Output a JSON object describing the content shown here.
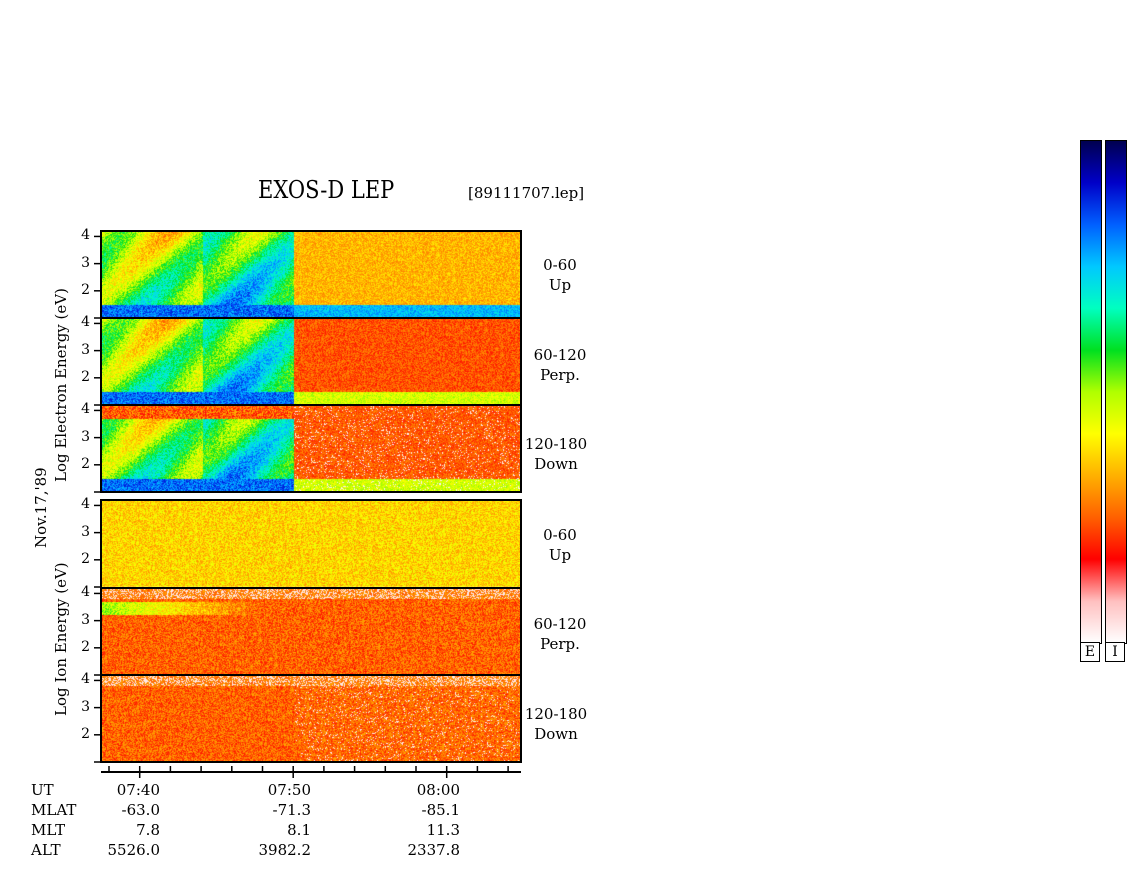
{
  "header": {
    "title": "EXOS-D LEP",
    "filename": "[89111707.lep]"
  },
  "date_label": "Nov.17,'89",
  "electron_axis_label": "Log  Electron  Energy (eV)",
  "ion_axis_label": "Log  Ion  Energy (eV)",
  "panels": [
    {
      "angle": "0-60",
      "direction": "Up"
    },
    {
      "angle": "60-120",
      "direction": "Perp."
    },
    {
      "angle": "120-180",
      "direction": "Down"
    },
    {
      "angle": "0-60",
      "direction": "Up"
    },
    {
      "angle": "60-120",
      "direction": "Perp."
    },
    {
      "angle": "120-180",
      "direction": "Down"
    }
  ],
  "ephemeris": {
    "rows": [
      {
        "label": "UT",
        "values": [
          "07:40",
          "07:50",
          "08:00"
        ]
      },
      {
        "label": "MLAT",
        "values": [
          "-63.0",
          "-71.3",
          "-85.1"
        ]
      },
      {
        "label": "MLT",
        "values": [
          "7.8",
          "8.1",
          "11.3"
        ]
      },
      {
        "label": "ALT",
        "values": [
          "5526.0",
          "3982.2",
          "2337.8"
        ]
      }
    ]
  },
  "colorbars": [
    {
      "label": "E"
    },
    {
      "label": "I"
    }
  ],
  "chart_data": {
    "type": "heatmap",
    "title": "EXOS-D LEP",
    "x_axis": {
      "label": "UT",
      "ticks": [
        "07:40",
        "07:50",
        "08:00"
      ]
    },
    "y_axis": {
      "label": "Log Energy (eV)",
      "ticks": [
        "2",
        "3",
        "4"
      ],
      "ylim": [
        1,
        4.2
      ]
    },
    "panels": [
      {
        "species": "Electron",
        "pitch_angle": "0-60",
        "direction": "Up"
      },
      {
        "species": "Electron",
        "pitch_angle": "60-120",
        "direction": "Perp."
      },
      {
        "species": "Electron",
        "pitch_angle": "120-180",
        "direction": "Down"
      },
      {
        "species": "Ion",
        "pitch_angle": "0-60",
        "direction": "Up"
      },
      {
        "species": "Ion",
        "pitch_angle": "60-120",
        "direction": "Perp."
      },
      {
        "species": "Ion",
        "pitch_angle": "120-180",
        "direction": "Down"
      }
    ],
    "colormap": [
      "#000050",
      "#0000c8",
      "#0060ff",
      "#00c8ff",
      "#00ffc0",
      "#00e020",
      "#b0ff00",
      "#ffff00",
      "#ffb000",
      "#ff6000",
      "#ff0000",
      "#ffc0c0",
      "#ffffff"
    ]
  }
}
